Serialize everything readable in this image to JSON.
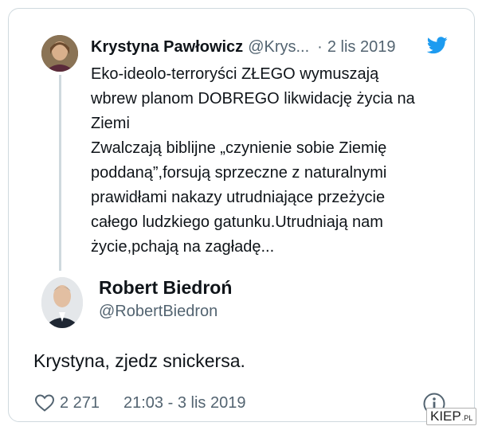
{
  "quoted_tweet": {
    "author_name": "Krystyna Pawłowicz",
    "author_handle": "@Krys...",
    "dot": "·",
    "date": "2 lis 2019",
    "text_lines": [
      "Eko-ideolo-terroryści ZŁEGO wymuszają",
      "wbrew planom DOBREGO likwidację życia na",
      "Ziemi",
      "Zwalczają biblijne „czynienie sobie Ziemię",
      "poddaną”,forsują sprzeczne z naturalnymi",
      "prawidłami nakazy utrudniające przeżycie",
      "całego ludzkiego gatunku.Utrudniają nam",
      "życie,pchają na zagładę..."
    ]
  },
  "main_tweet": {
    "author_name": "Robert Biedroń",
    "author_handle": "@RobertBiedron",
    "text": "Krystyna, zjedz snickersa.",
    "likes": "2 271",
    "timestamp": "21:03 - 3 lis 2019"
  },
  "watermark": {
    "main": "KIEP",
    "suffix": ".PL"
  },
  "icons": {
    "brand": "twitter-bird-icon",
    "like": "heart-icon",
    "info": "info-icon"
  },
  "colors": {
    "twitter_blue": "#1d9bf0",
    "secondary_text": "#536471",
    "border": "#cfd9de"
  }
}
